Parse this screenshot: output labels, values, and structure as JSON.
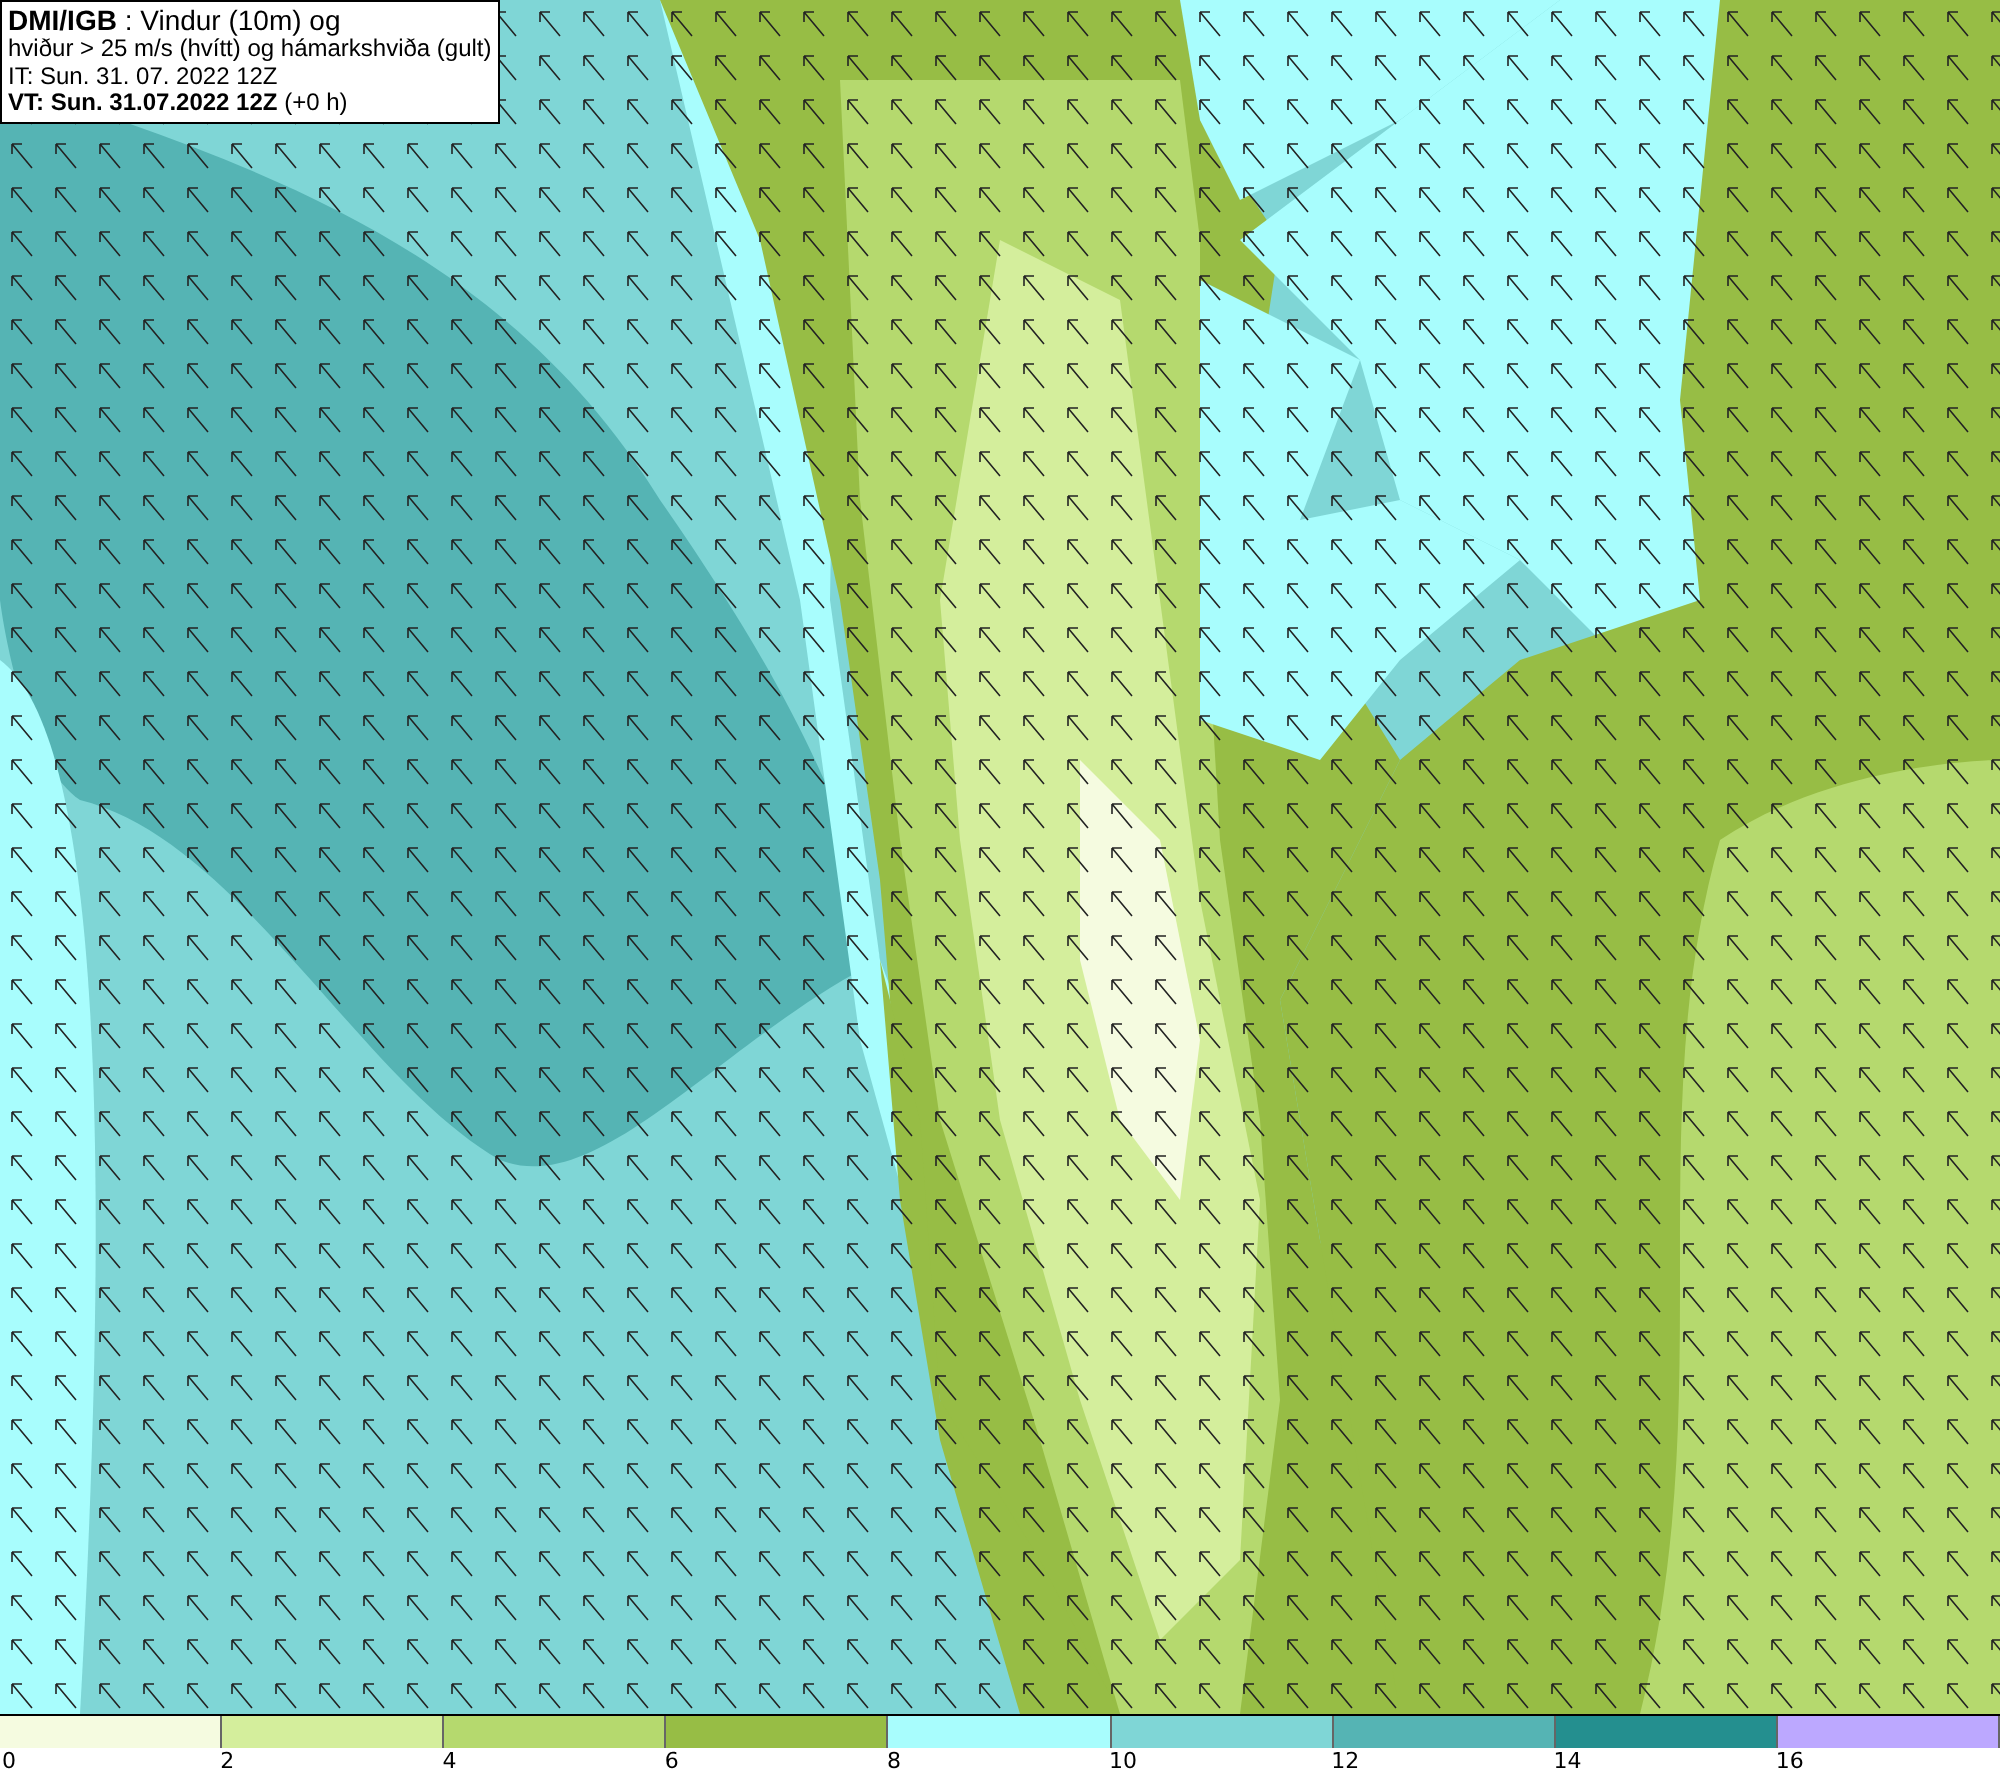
{
  "header": {
    "lines": [
      "**DMI/IGB** : Vindur (10m) og",
      "hviður > 25 m/s (hvítt) og hámarkshviða (gult)",
      "IT: Sun. 31. 07. 2022 12Z",
      "**VT: Sun. 31.07.2022 12Z** (+0 h)"
    ]
  },
  "legend": {
    "bins": [
      {
        "color": "#f5fbe0"
      },
      {
        "color": "#d4ee9c"
      },
      {
        "color": "#b5d96e"
      },
      {
        "color": "#97bd45"
      },
      {
        "color": "#a8fdfd"
      },
      {
        "color": "#7fd6d6"
      },
      {
        "color": "#55b4b4"
      },
      {
        "color": "#248f8f"
      },
      {
        "color": "#bca8ff"
      }
    ],
    "ticks": [
      "0",
      "2",
      "4",
      "6",
      "8",
      "10",
      "12",
      "14",
      "16"
    ]
  }
}
